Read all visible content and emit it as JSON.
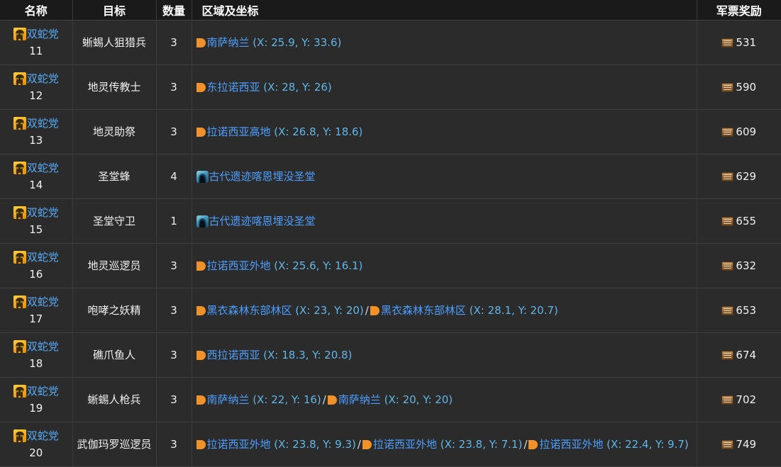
{
  "table": {
    "columns": [
      {
        "key": "name",
        "label": "名称"
      },
      {
        "key": "target",
        "label": "目标"
      },
      {
        "key": "qty",
        "label": "数量"
      },
      {
        "key": "area",
        "label": "区域及坐标"
      },
      {
        "key": "reward",
        "label": "军票奖励"
      }
    ],
    "icons": {
      "grand_company": "gc-badge-icon",
      "map_marker": "map-marker-icon",
      "cave_entrance": "cave-entrance-icon",
      "military_seal": "military-seal-icon"
    },
    "colors": {
      "header_bg": "#1a1a1a",
      "row_bg": "#2b2b2b",
      "border": "#3f3f3f",
      "text": "#f2f2f2",
      "link_blue": "#4d9fff",
      "coord_blue": "#61b6e8",
      "gc_link_blue": "#56a9f5",
      "marker_orange": "#f0912a",
      "badge_gold": "#f5a814",
      "seal_brown": "#8d6134"
    },
    "rows": [
      {
        "company": "双蛇党",
        "number": "11",
        "target": "蜥蜴人狙猎兵",
        "qty": "3",
        "locations": [
          {
            "icon": "map_marker",
            "place": "南萨纳兰",
            "coords": "(X: 25.9, Y: 33.6)"
          }
        ],
        "reward": "531"
      },
      {
        "company": "双蛇党",
        "number": "12",
        "target": "地灵传教士",
        "qty": "3",
        "locations": [
          {
            "icon": "map_marker",
            "place": "东拉诺西亚",
            "coords": "(X: 28, Y: 26)"
          }
        ],
        "reward": "590"
      },
      {
        "company": "双蛇党",
        "number": "13",
        "target": "地灵助祭",
        "qty": "3",
        "locations": [
          {
            "icon": "map_marker",
            "place": "拉诺西亚高地",
            "coords": "(X: 26.8, Y: 18.6)"
          }
        ],
        "reward": "609"
      },
      {
        "company": "双蛇党",
        "number": "14",
        "target": "圣堂蜂",
        "qty": "4",
        "locations": [
          {
            "icon": "cave_entrance",
            "place": "古代遗迹喀恩埋没圣堂",
            "coords": ""
          }
        ],
        "reward": "629"
      },
      {
        "company": "双蛇党",
        "number": "15",
        "target": "圣堂守卫",
        "qty": "1",
        "locations": [
          {
            "icon": "cave_entrance",
            "place": "古代遗迹喀恩埋没圣堂",
            "coords": ""
          }
        ],
        "reward": "655"
      },
      {
        "company": "双蛇党",
        "number": "16",
        "target": "地灵巡逻员",
        "qty": "3",
        "locations": [
          {
            "icon": "map_marker",
            "place": "拉诺西亚外地",
            "coords": "(X: 25.6, Y: 16.1)"
          }
        ],
        "reward": "632"
      },
      {
        "company": "双蛇党",
        "number": "17",
        "target": "咆哮之妖精",
        "qty": "3",
        "locations": [
          {
            "icon": "map_marker",
            "place": "黑衣森林东部林区",
            "coords": "(X: 23, Y: 20)"
          },
          {
            "icon": "map_marker",
            "place": "黑衣森林东部林区",
            "coords": "(X: 28.1, Y: 20.7)"
          }
        ],
        "reward": "653"
      },
      {
        "company": "双蛇党",
        "number": "18",
        "target": "礁爪鱼人",
        "qty": "3",
        "locations": [
          {
            "icon": "map_marker",
            "place": "西拉诺西亚",
            "coords": "(X: 18.3, Y: 20.8)"
          }
        ],
        "reward": "674"
      },
      {
        "company": "双蛇党",
        "number": "19",
        "target": "蜥蜴人枪兵",
        "qty": "3",
        "locations": [
          {
            "icon": "map_marker",
            "place": "南萨纳兰",
            "coords": "(X: 22, Y: 16)"
          },
          {
            "icon": "map_marker",
            "place": "南萨纳兰",
            "coords": "(X: 20, Y: 20)"
          }
        ],
        "reward": "702"
      },
      {
        "company": "双蛇党",
        "number": "20",
        "target": "武伽玛罗巡逻员",
        "qty": "3",
        "locations": [
          {
            "icon": "map_marker",
            "place": "拉诺西亚外地",
            "coords": "(X: 23.8, Y: 9.3)"
          },
          {
            "icon": "map_marker",
            "place": "拉诺西亚外地",
            "coords": "(X: 23.8, Y: 7.1)"
          },
          {
            "icon": "map_marker",
            "place": "拉诺西亚外地",
            "coords": "(X: 22.4, Y: 9.7)"
          }
        ],
        "reward": "749"
      }
    ]
  }
}
